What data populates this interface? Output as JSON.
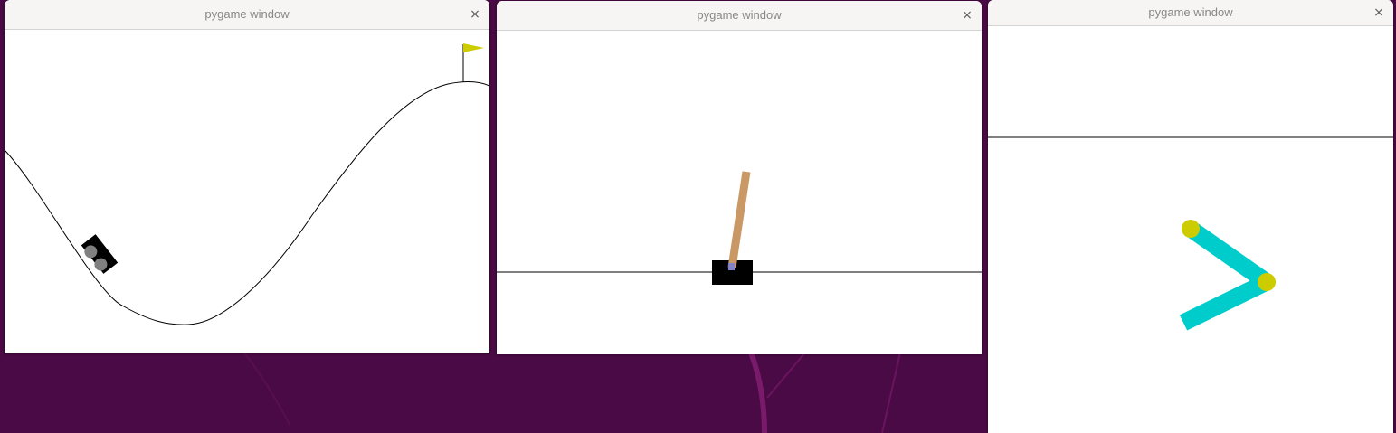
{
  "desktop": {
    "background_color": "#4a0a45"
  },
  "windows": [
    {
      "title": "pygame window",
      "close_label": "×",
      "scene": "mountain-car",
      "colors": {
        "flag": "#cccc00",
        "car_body": "#000000",
        "wheels": "#808080",
        "track": "#000000"
      }
    },
    {
      "title": "pygame window",
      "close_label": "×",
      "scene": "cartpole",
      "colors": {
        "cart": "#000000",
        "pole": "#ca9865",
        "axle": "#8184cb",
        "track": "#000000"
      }
    },
    {
      "title": "pygame window",
      "close_label": "×",
      "scene": "acrobot",
      "colors": {
        "links": "#00cccc",
        "joints": "#cccc00",
        "target_line": "#000000"
      }
    }
  ]
}
